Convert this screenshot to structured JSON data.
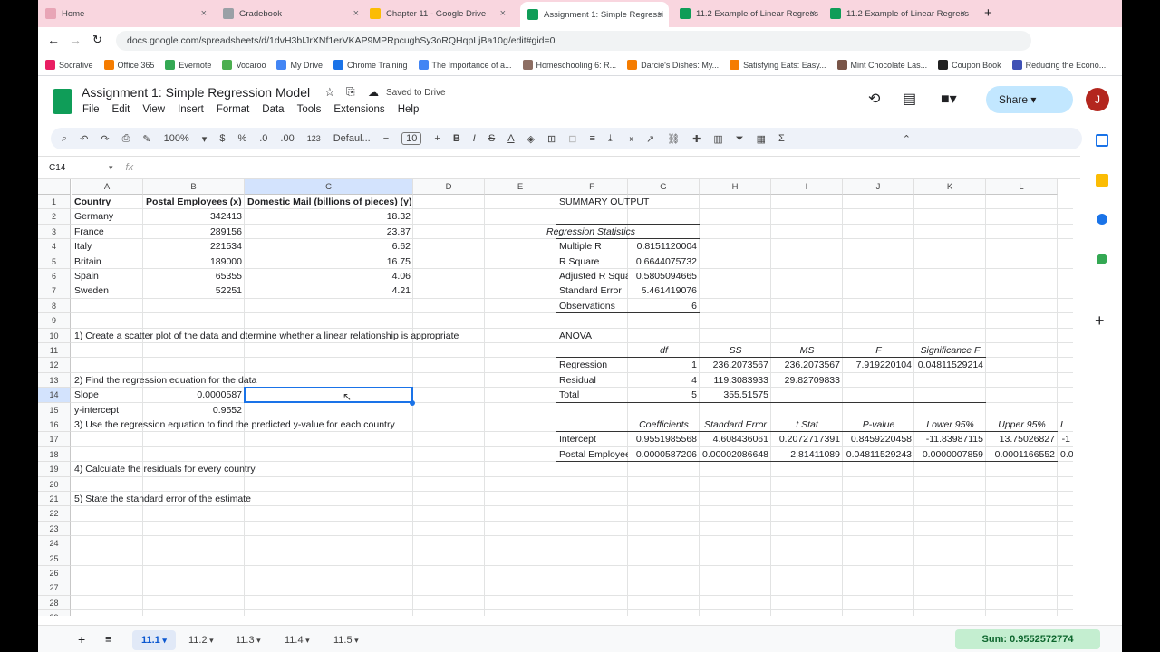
{
  "tabs": [
    {
      "label": "Home",
      "color": "#e8a5b6"
    },
    {
      "label": "Gradebook",
      "color": "#9aa0a6"
    },
    {
      "label": "Chapter 11 - Google Drive",
      "color": "#fbbc04"
    },
    {
      "label": "Assignment 1: Simple Regressi",
      "color": "#0f9d58"
    },
    {
      "label": "11.2 Example of Linear Regress",
      "color": "#0f9d58"
    },
    {
      "label": "11.2 Example of Linear Regress",
      "color": "#0f9d58"
    }
  ],
  "url": "docs.google.com/spreadsheets/d/1dvH3bIJrXNf1erVKAP9MPRpcughSy3oRQHqpLjBa10g/edit#gid=0",
  "bookmarks": [
    "Socrative",
    "Office 365",
    "Evernote",
    "Vocaroo",
    "My Drive",
    "Chrome Training",
    "The Importance of a...",
    "Homeschooling 6: R...",
    "Darcie's Dishes: My...",
    "Satisfying Eats: Easy...",
    "Mint Chocolate Las...",
    "Coupon Book",
    "Reducing the Econo..."
  ],
  "doc": {
    "title": "Assignment 1: Simple Regression Model",
    "saved": "Saved to Drive",
    "share": "Share",
    "avatar": "J"
  },
  "menus": [
    "File",
    "Edit",
    "View",
    "Insert",
    "Format",
    "Data",
    "Tools",
    "Extensions",
    "Help"
  ],
  "toolbar": {
    "zoom": "100%",
    "currency": "$",
    "percent": "%",
    "dec_less": ".0",
    "dec_more": ".00",
    "num_format": "123",
    "font": "Defaul...",
    "font_size": "10"
  },
  "namebox": "C14",
  "fx": "fx",
  "columns": [
    "A",
    "B",
    "C",
    "D",
    "E",
    "F",
    "G",
    "H",
    "I",
    "J",
    "K",
    "L"
  ],
  "rows": [
    "1",
    "2",
    "3",
    "4",
    "5",
    "6",
    "7",
    "8",
    "9",
    "10",
    "11",
    "12",
    "13",
    "14",
    "15",
    "16",
    "17",
    "18",
    "19",
    "20",
    "21",
    "22",
    "23",
    "24",
    "25",
    "26",
    "27",
    "28",
    "29"
  ],
  "cells": {
    "A1": "Country",
    "B1": "Postal Employees (x)",
    "C1": "Domestic Mail (billions of pieces) (y)",
    "A2": "Germany",
    "B2": "342413",
    "C2": "18.32",
    "A3": "France",
    "B3": "289156",
    "C3": "23.87",
    "A4": "Italy",
    "B4": "221534",
    "C4": "6.62",
    "A5": "Britain",
    "B5": "189000",
    "C5": "16.75",
    "A6": "Spain",
    "B6": "65355",
    "C6": "4.06",
    "A7": "Sweden",
    "B7": "52251",
    "C7": "4.21",
    "A10": "1) Create a scatter plot of the data and dtermine whether a linear relationship is appropriate",
    "A13": "2) Find the regression equation for the data",
    "A14": "Slope",
    "B14": "0.0000587",
    "A15": "y-intercept",
    "B15": "0.9552",
    "A16": "3) Use the regression equation to find the predicted y-value for each country",
    "A19": "4) Calculate the residuals for every country",
    "A21": "5) State the standard error of the estimate",
    "F1": "SUMMARY OUTPUT",
    "F3": "Regression Statistics",
    "F4": "Multiple R",
    "G4": "0.8151120004",
    "F5": "R Square",
    "G5": "0.6644075732",
    "F6": "Adjusted R Squa",
    "G6": "0.5805094665",
    "F7": "Standard Error",
    "G7": "5.461419076",
    "F8": "Observations",
    "G8": "6",
    "F10": "ANOVA",
    "G11": "df",
    "H11": "SS",
    "I11": "MS",
    "J11": "F",
    "K11": "Significance F",
    "F12": "Regression",
    "G12": "1",
    "H12": "236.2073567",
    "I12": "236.2073567",
    "J12": "7.919220104",
    "K12": "0.04811529214",
    "F13": "Residual",
    "G13": "4",
    "H13": "119.3083933",
    "I13": "29.82709833",
    "F14": "Total",
    "G14": "5",
    "H14": "355.51575",
    "G16": "Coefficients",
    "H16": "Standard Error",
    "I16": "t Stat",
    "J16": "P-value",
    "K16": "Lower 95%",
    "L16": "Upper 95%",
    "M16": "L",
    "F17": "Intercept",
    "G17": "0.9551985568",
    "H17": "4.608436061",
    "I17": "0.2072717391",
    "J17": "0.8459220458",
    "K17": "-11.83987115",
    "L17": "13.75026827",
    "M17": "-1",
    "F18": "Postal Employee",
    "G18": "0.0000587206",
    "H18": "0.00002086648",
    "I18": "2.81411089",
    "J18": "0.04811529243",
    "K18": "0.0000007859",
    "L18": "0.0001166552",
    "M18": "0.0"
  },
  "sheets": [
    "11.1",
    "11.2",
    "11.3",
    "11.4",
    "11.5"
  ],
  "sum": "Sum: 0.9552572774"
}
